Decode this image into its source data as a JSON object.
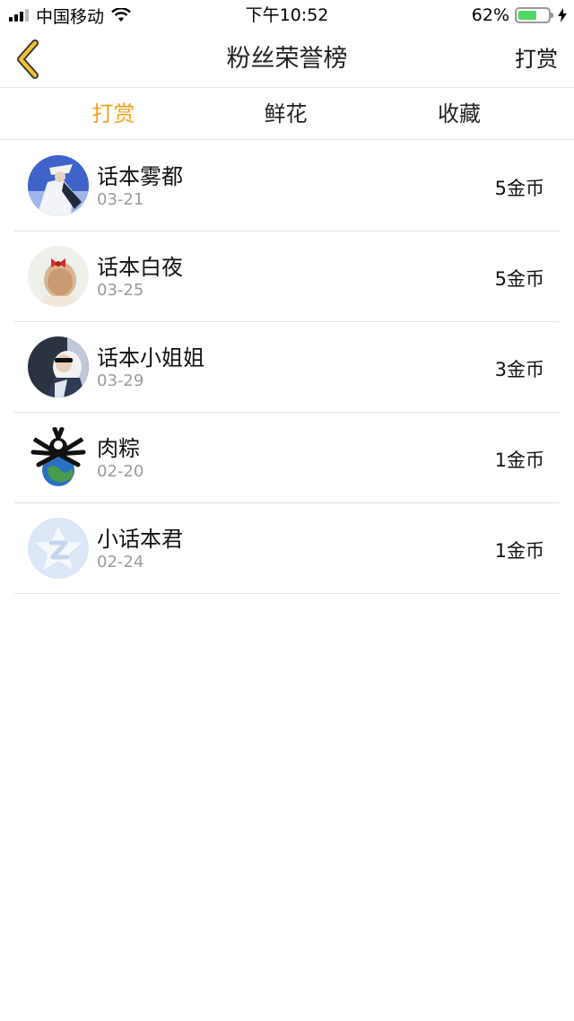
{
  "status": {
    "carrier": "中国移动",
    "time": "下午10:52",
    "battery_percent": "62%",
    "battery_level": 0.62
  },
  "nav": {
    "title": "粉丝荣誉榜",
    "right_label": "打赏",
    "back_icon": "chevron-left-icon"
  },
  "tabs": [
    {
      "label": "打赏",
      "active": true
    },
    {
      "label": "鲜花",
      "active": false
    },
    {
      "label": "收藏",
      "active": false
    }
  ],
  "colors": {
    "accent": "#f1a21b",
    "divider": "#e3e3e3",
    "subtext": "#9b9b9b"
  },
  "fans": [
    {
      "name": "话本雾都",
      "date": "03-21",
      "amount": "5金币"
    },
    {
      "name": "话本白夜",
      "date": "03-25",
      "amount": "5金币"
    },
    {
      "name": "话本小姐姐",
      "date": "03-29",
      "amount": "3金币"
    },
    {
      "name": "肉粽",
      "date": "02-20",
      "amount": "1金币"
    },
    {
      "name": "小话本君",
      "date": "02-24",
      "amount": "1金币"
    }
  ]
}
